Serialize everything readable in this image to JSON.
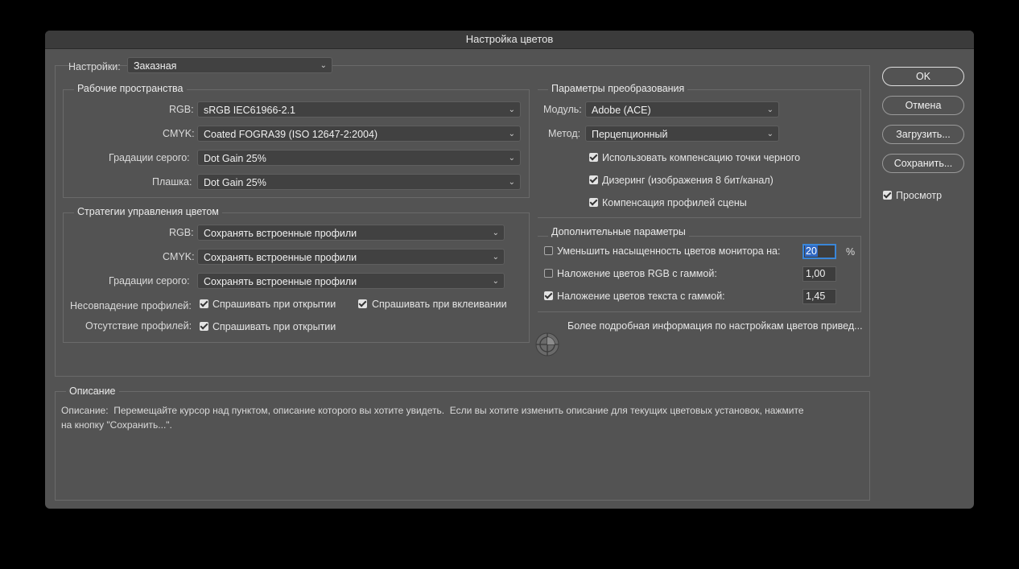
{
  "window": {
    "title": "Настройка цветов"
  },
  "settings": {
    "label": "Настройки:",
    "value": "Заказная"
  },
  "working_spaces": {
    "title": "Рабочие пространства",
    "rgb_label": "RGB:",
    "rgb_value": "sRGB IEC61966-2.1",
    "cmyk_label": "CMYK:",
    "cmyk_value": "Coated FOGRA39 (ISO 12647-2:2004)",
    "gray_label": "Градации серого:",
    "gray_value": "Dot Gain 25%",
    "spot_label": "Плашка:",
    "spot_value": "Dot Gain 25%"
  },
  "policies": {
    "title": "Стратегии управления цветом",
    "rgb_label": "RGB:",
    "rgb_value": "Сохранять встроенные профили",
    "cmyk_label": "CMYK:",
    "cmyk_value": "Сохранять встроенные профили",
    "gray_label": "Градации серого:",
    "gray_value": "Сохранять встроенные профили",
    "mismatch_label": "Несовпадение профилей:",
    "mismatch_open": {
      "label": "Спрашивать при открытии",
      "checked": true
    },
    "mismatch_paste": {
      "label": "Спрашивать при вклеивании",
      "checked": true
    },
    "missing_label": "Отсутствие профилей:",
    "missing_open": {
      "label": "Спрашивать при открытии",
      "checked": true
    }
  },
  "conversion": {
    "title": "Параметры преобразования",
    "engine_label": "Модуль:",
    "engine_value": "Adobe (ACE)",
    "intent_label": "Метод:",
    "intent_value": "Перцепционный",
    "bpc": {
      "label": "Использовать компенсацию точки черного",
      "checked": true
    },
    "dither": {
      "label": "Дизеринг (изображения 8 бит/канал)",
      "checked": true
    },
    "scene": {
      "label": "Компенсация профилей сцены",
      "checked": true
    }
  },
  "advanced": {
    "title": "Дополнительные параметры",
    "desaturate": {
      "label": "Уменьшить насыщенность цветов монитора на:",
      "checked": false,
      "value": "20",
      "unit": "%"
    },
    "blend_rgb": {
      "label": "Наложение цветов RGB с гаммой:",
      "checked": false,
      "value": "1,00"
    },
    "blend_text": {
      "label": "Наложение цветов текста с гаммой:",
      "checked": true,
      "value": "1,45"
    }
  },
  "info_text": "Более подробная информация по настройкам цветов привед...",
  "buttons": {
    "ok": "OK",
    "cancel": "Отмена",
    "load": "Загрузить...",
    "save": "Сохранить..."
  },
  "preview": {
    "label": "Просмотр",
    "checked": true
  },
  "description": {
    "title": "Описание",
    "line1": "Описание:  Перемещайте курсор над пунктом, описание которого вы хотите увидеть.  Если вы хотите изменить описание для текущих цветовых установок, нажмите",
    "line2": "на кнопку \"Сохранить...\"."
  },
  "icons": {
    "chevron": "chevron-down-icon",
    "info": "color-wheel-info-icon"
  },
  "colors": {
    "window_bg": "#535353",
    "field_bg": "#414141",
    "focus": "#3a86d8"
  }
}
